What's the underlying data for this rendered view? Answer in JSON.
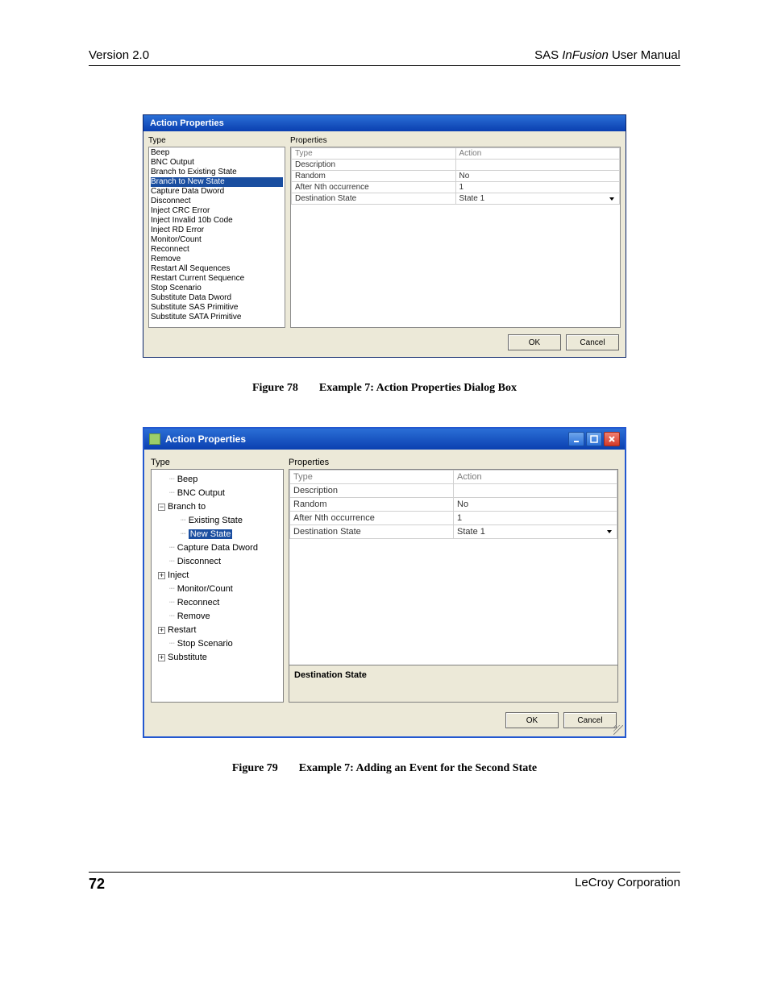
{
  "header": {
    "left": "Version 2.0",
    "right_prefix": "SAS ",
    "right_italic": "InFusion",
    "right_suffix": " User Manual"
  },
  "dialog1": {
    "title": "Action Properties",
    "labels": {
      "type": "Type",
      "properties": "Properties"
    },
    "type_list": [
      "Beep",
      "BNC Output",
      "Branch to Existing State",
      "Branch to New State",
      "Capture Data Dword",
      "Disconnect",
      "Inject CRC Error",
      "Inject Invalid 10b Code",
      "Inject RD Error",
      "Monitor/Count",
      "Reconnect",
      "Remove",
      "Restart All Sequences",
      "Restart Current Sequence",
      "Stop Scenario",
      "Substitute Data Dword",
      "Substitute SAS Primitive",
      "Substitute SATA Primitive"
    ],
    "type_selected_index": 3,
    "properties_rows": [
      {
        "k": "Type",
        "v": "Action",
        "grey": true
      },
      {
        "k": "Description",
        "v": ""
      },
      {
        "k": "Random",
        "v": "No"
      },
      {
        "k": "After Nth occurrence",
        "v": "1"
      },
      {
        "k": "Destination State",
        "v": "State 1",
        "dropdown": true
      }
    ],
    "buttons": {
      "ok": "OK",
      "cancel": "Cancel"
    }
  },
  "figure78": {
    "num": "Figure 78",
    "title": "Example 7: Action Properties Dialog Box"
  },
  "dialog2": {
    "title": "Action Properties",
    "labels": {
      "type": "Type",
      "properties": "Properties"
    },
    "tree": [
      {
        "depth": 1,
        "label": "Beep",
        "prefix": "conn"
      },
      {
        "depth": 1,
        "label": "BNC Output",
        "prefix": "conn"
      },
      {
        "depth": 0,
        "label": "Branch to",
        "prefix": "minus"
      },
      {
        "depth": 2,
        "label": "Existing State",
        "prefix": "conn"
      },
      {
        "depth": 2,
        "label": "New State",
        "prefix": "conn",
        "selected": true
      },
      {
        "depth": 1,
        "label": "Capture Data Dword",
        "prefix": "conn"
      },
      {
        "depth": 1,
        "label": "Disconnect",
        "prefix": "conn"
      },
      {
        "depth": 0,
        "label": "Inject",
        "prefix": "plus"
      },
      {
        "depth": 1,
        "label": "Monitor/Count",
        "prefix": "conn"
      },
      {
        "depth": 1,
        "label": "Reconnect",
        "prefix": "conn"
      },
      {
        "depth": 1,
        "label": "Remove",
        "prefix": "conn"
      },
      {
        "depth": 0,
        "label": "Restart",
        "prefix": "plus"
      },
      {
        "depth": 1,
        "label": "Stop Scenario",
        "prefix": "conn"
      },
      {
        "depth": 0,
        "label": "Substitute",
        "prefix": "plus"
      }
    ],
    "properties_rows": [
      {
        "k": "Type",
        "v": "Action",
        "grey": true
      },
      {
        "k": "Description",
        "v": ""
      },
      {
        "k": "Random",
        "v": "No"
      },
      {
        "k": "After Nth occurrence",
        "v": "1"
      },
      {
        "k": "Destination State",
        "v": "State 1",
        "dropdown": true
      }
    ],
    "desc_pane": "Destination State",
    "buttons": {
      "ok": "OK",
      "cancel": "Cancel"
    }
  },
  "figure79": {
    "num": "Figure 79",
    "title": "Example 7: Adding an Event for the Second State"
  },
  "footer": {
    "page": "72",
    "company": "LeCroy Corporation"
  }
}
